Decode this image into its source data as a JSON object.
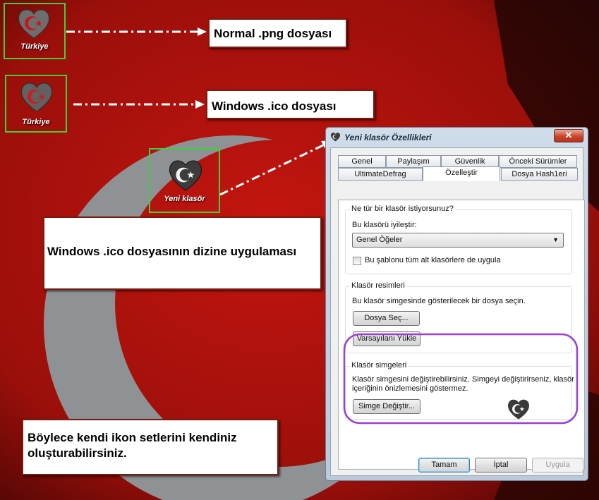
{
  "desktop": {
    "icons": [
      {
        "label": "Türkiye"
      },
      {
        "label": "Türkiye"
      },
      {
        "label": "Yeni klasör"
      }
    ]
  },
  "callouts": {
    "png": "Normal .png dosyası",
    "ico": "Windows .ico dosyası",
    "apply": "Windows .ico dosyasının  dizine uygulaması",
    "summary": "Böylece kendi ikon setlerini kendiniz oluşturabilirsiniz."
  },
  "dialog": {
    "title": "Yeni klasör Özellikleri",
    "close": "✕",
    "tabs_row1": [
      "Genel",
      "Paylaşım",
      "Güvenlik",
      "Önceki Sürümler"
    ],
    "tabs_row2": [
      "UltimateDefrag",
      "Özelleştir",
      "Dosya Hash1eri"
    ],
    "active_tab": "Özelleştir",
    "group1": {
      "title": "Ne tür bir klasör istiyorsunuz?",
      "optimize_label": "Bu klasörü iyileştir:",
      "select_value": "Genel Öğeler",
      "checkbox_label": "Bu şablonu tüm alt klasörlere de uygula"
    },
    "group2": {
      "title": "Klasör resimleri",
      "description": "Bu klasör simgesinde gösterilecek bir dosya seçin.",
      "choose_file": "Dosya Seç...",
      "restore_default": "Varsayılanı Yükle"
    },
    "group3": {
      "title": "Klasör simgeleri",
      "description_line1": "Klasör simgesini değiştirebilirsiniz. Simgeyi değiştirirseniz, klasör",
      "description_line2": "içeriğinin önizlemesini göstermez.",
      "change_icon": "Simge Değiştir..."
    },
    "buttons": {
      "ok": "Tamam",
      "cancel": "İptal",
      "apply": "Uygula"
    }
  },
  "colors": {
    "background_red": "#b3130d",
    "highlight_green": "#3fcf3f",
    "highlight_purple": "#9b3fd9",
    "heart_grey": "#5a5a5a"
  }
}
